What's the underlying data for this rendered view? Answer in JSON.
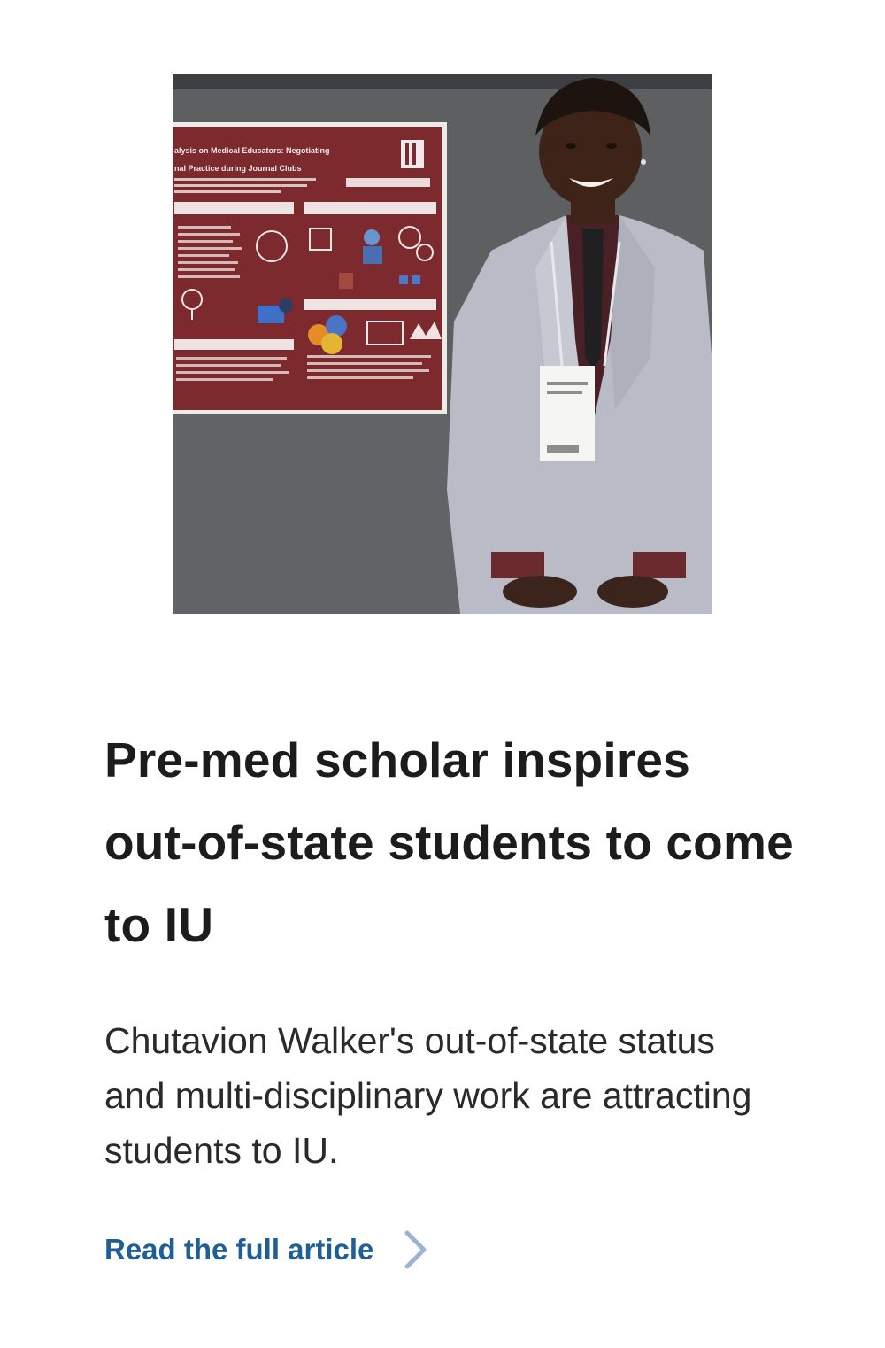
{
  "article": {
    "image": {
      "alt": "Student in a grey suit standing beside a research poster",
      "poster_title_line1": "alysis on Medical Educators: Negotiating",
      "poster_title_line2": "nal Practice during Journal Clubs"
    },
    "headline": "Pre-med scholar inspires out-of-state students to come to IU",
    "summary": "Chutavion Walker's out-of-state status and multi-disciplinary work are attracting students to IU.",
    "read_more": {
      "label": "Read the full article",
      "icon": "chevron-right-icon"
    }
  },
  "colors": {
    "headline": "#1c1c1c",
    "body_text": "#2a2a2a",
    "link": "#1f5f95",
    "chevron": "#9bb4d2",
    "poster_maroon": "#7c2a2e",
    "backdrop": "#5d5e60",
    "suit": "#b9bcc6"
  }
}
